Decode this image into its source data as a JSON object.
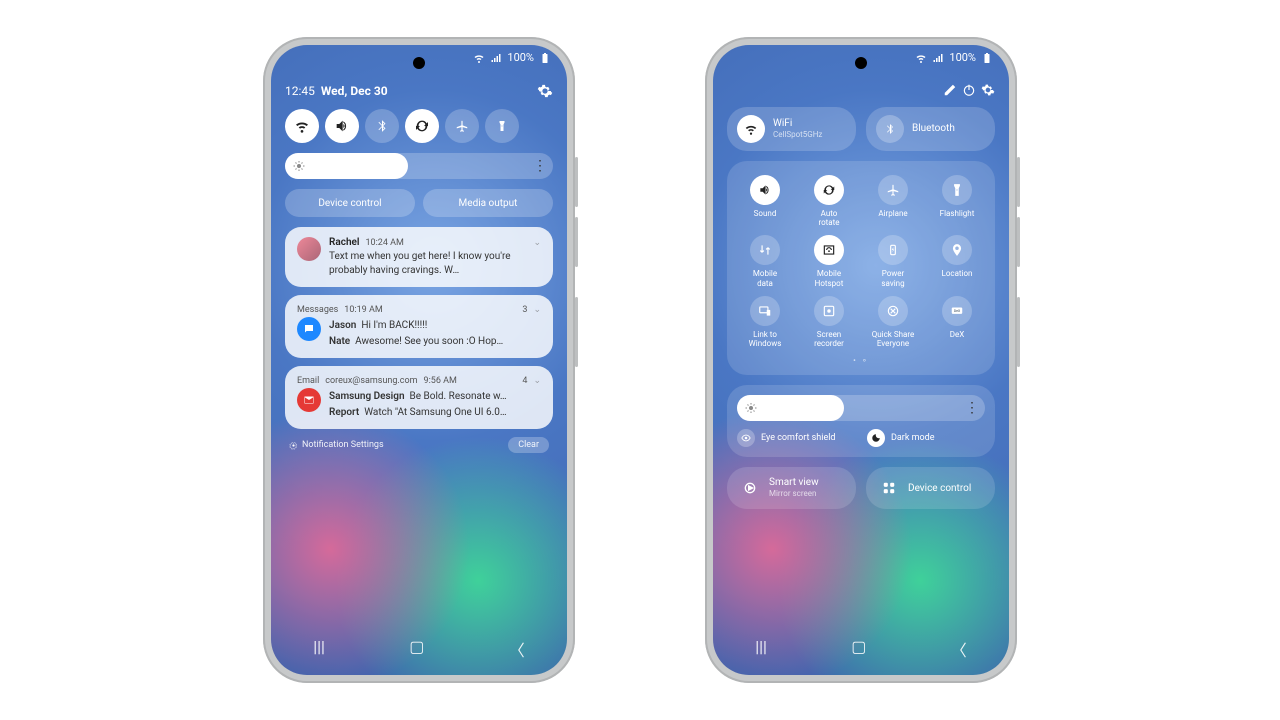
{
  "status": {
    "battery": "100%"
  },
  "left": {
    "time": "12:45",
    "date": "Wed, Dec 30",
    "device_control": "Device control",
    "media_output": "Media output",
    "brightness_pct": 43,
    "notif1": {
      "title": "Rachel",
      "time": "10:24 AM",
      "body": "Text me when you get here! I know you're probably having cravings. W…"
    },
    "notif2": {
      "app": "Messages",
      "time": "10:19 AM",
      "count": "3",
      "l1s": "Jason",
      "l1b": "Hi I'm BACK!!!!!",
      "l2s": "Nate",
      "l2b": "Awesome! See you soon :O Hop…"
    },
    "notif3": {
      "app": "Email",
      "addr": "coreux@samsung.com",
      "time": "9:56 AM",
      "count": "4",
      "l1s": "Samsung Design",
      "l1b": "Be Bold. Resonate w…",
      "l2s": "Report",
      "l2b": "Watch \"At Samsung One UI 6.0…"
    },
    "settings": "Notification Settings",
    "clear": "Clear"
  },
  "right": {
    "wifi": {
      "label": "WiFi",
      "sub": "CellSpot5GHz"
    },
    "bt": {
      "label": "Bluetooth"
    },
    "tiles": [
      {
        "label": "Sound",
        "on": true
      },
      {
        "label": "Auto rotate",
        "on": true
      },
      {
        "label": "Airplane",
        "on": false
      },
      {
        "label": "Flashlight",
        "on": false
      },
      {
        "label": "Mobile data",
        "on": false
      },
      {
        "label": "Mobile Hotspot",
        "on": true
      },
      {
        "label": "Power saving",
        "on": false
      },
      {
        "label": "Location",
        "on": false
      },
      {
        "label": "Link to Windows",
        "on": false
      },
      {
        "label": "Screen recorder",
        "on": false
      },
      {
        "label": "Quick Share Everyone",
        "on": false
      },
      {
        "label": "DeX",
        "on": false
      }
    ],
    "brightness_pct": 40,
    "eye": "Eye comfort shield",
    "dark": "Dark mode",
    "smartview": {
      "label": "Smart view",
      "sub": "Mirror screen"
    },
    "devctrl": "Device control"
  }
}
